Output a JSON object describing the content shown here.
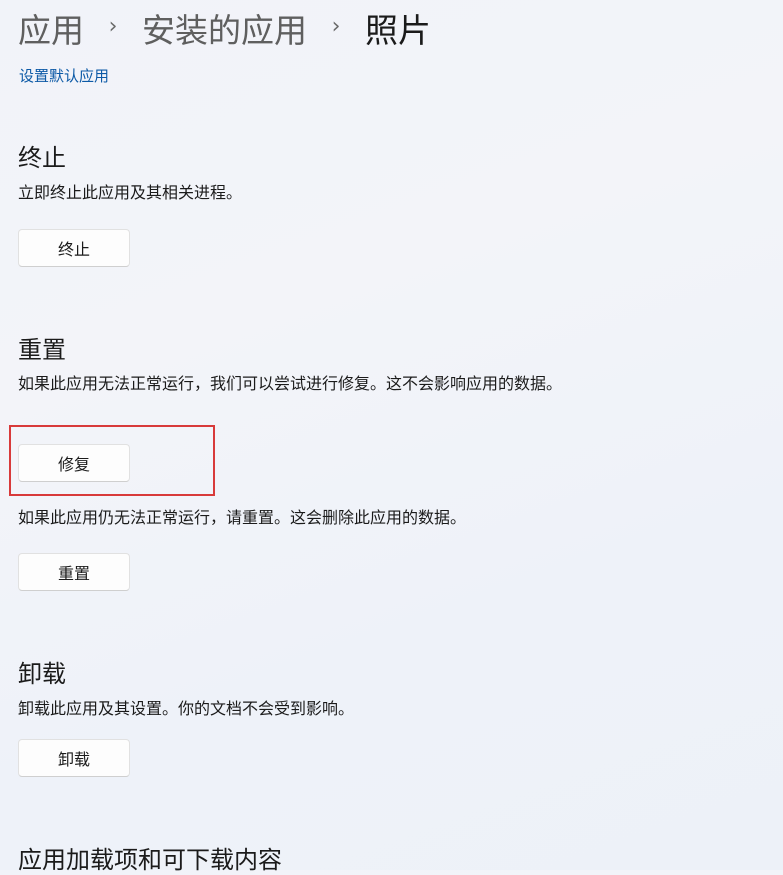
{
  "breadcrumb": {
    "items": [
      "应用",
      "安装的应用",
      "照片"
    ],
    "separator": "›"
  },
  "set_default_link": "设置默认应用",
  "terminate": {
    "heading": "终止",
    "description": "立即终止此应用及其相关进程。",
    "button": "终止"
  },
  "reset": {
    "heading": "重置",
    "repair_description": "如果此应用无法正常运行，我们可以尝试进行修复。这不会影响应用的数据。",
    "repair_button": "修复",
    "reset_description": "如果此应用仍无法正常运行，请重置。这会删除此应用的数据。",
    "reset_button": "重置"
  },
  "uninstall": {
    "heading": "卸载",
    "description": "卸载此应用及其设置。你的文档不会受到影响。",
    "button": "卸载"
  },
  "addons": {
    "heading": "应用加载项和可下载内容"
  },
  "colors": {
    "link": "#0c59a6",
    "highlight": "#d83a3a"
  }
}
